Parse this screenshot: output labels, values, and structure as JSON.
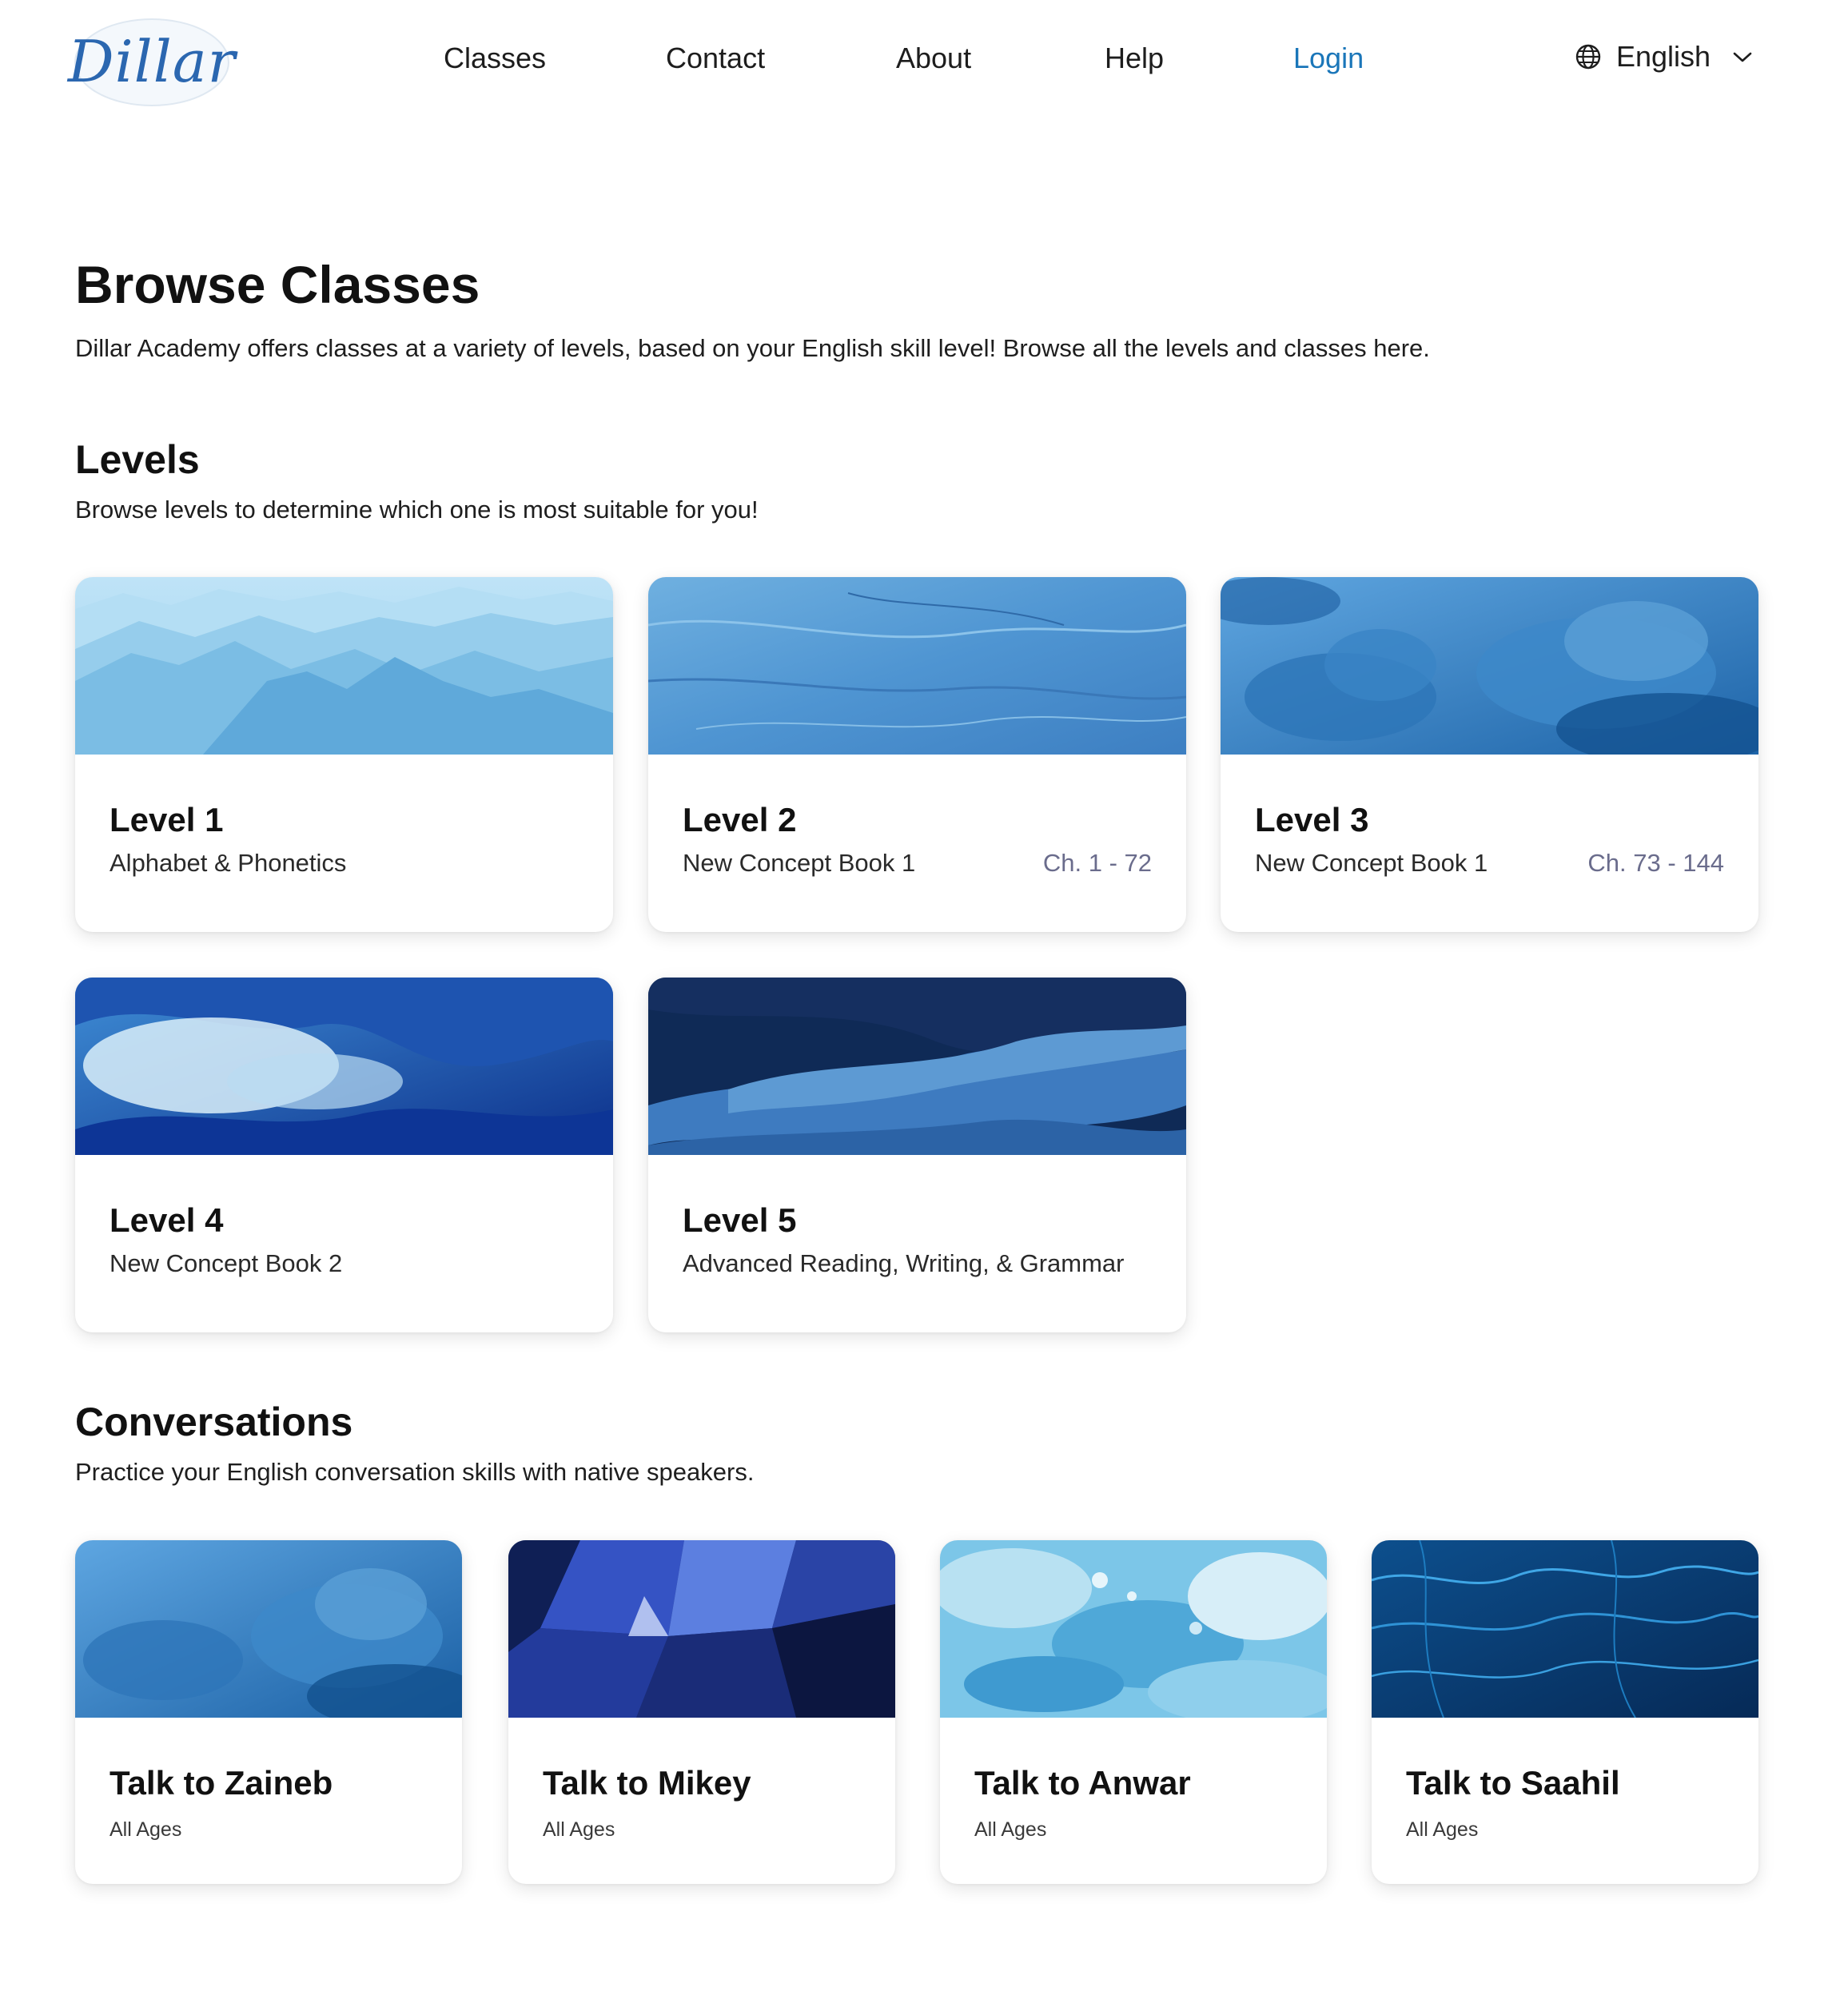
{
  "header": {
    "logo_text": "Dillar",
    "nav": [
      {
        "label": "Classes"
      },
      {
        "label": "Contact"
      },
      {
        "label": "About"
      },
      {
        "label": "Help"
      },
      {
        "label": "Login",
        "active": true
      }
    ],
    "language": {
      "selected": "English",
      "icon": "globe-icon",
      "dropdown_icon": "chevron-down-icon"
    },
    "accent_color": "#1a76b9"
  },
  "page": {
    "title": "Browse Classes",
    "description": "Dillar Academy offers classes at a variety of levels, based on your English skill level! Browse all the levels and classes here."
  },
  "levels": {
    "title": "Levels",
    "description": "Browse levels to determine which one is most suitable for you!",
    "cards": [
      {
        "title": "Level 1",
        "subtitle": "Alphabet & Phonetics",
        "chapters": "",
        "image": "misty-mountains"
      },
      {
        "title": "Level 2",
        "subtitle": "New Concept Book 1",
        "chapters": "Ch. 1 - 72",
        "image": "snow-surface"
      },
      {
        "title": "Level 3",
        "subtitle": "New Concept Book 1",
        "chapters": "Ch. 73 - 144",
        "image": "blue-clouds"
      },
      {
        "title": "Level 4",
        "subtitle": "New Concept Book 2",
        "chapters": "",
        "image": "ocean-waves"
      },
      {
        "title": "Level 5",
        "subtitle": "Advanced Reading, Writing, & Grammar",
        "chapters": "",
        "image": "glacier-ice"
      }
    ]
  },
  "conversations": {
    "title": "Conversations",
    "description": "Practice your English conversation skills with native speakers.",
    "cards": [
      {
        "title": "Talk to Zaineb",
        "subtitle": "All Ages",
        "image": "blue-clouds"
      },
      {
        "title": "Talk to Mikey",
        "subtitle": "All Ages",
        "image": "glass-building"
      },
      {
        "title": "Talk to Anwar",
        "subtitle": "All Ages",
        "image": "fluid-paint"
      },
      {
        "title": "Talk to Saahil",
        "subtitle": "All Ages",
        "image": "water-caustics"
      }
    ]
  }
}
